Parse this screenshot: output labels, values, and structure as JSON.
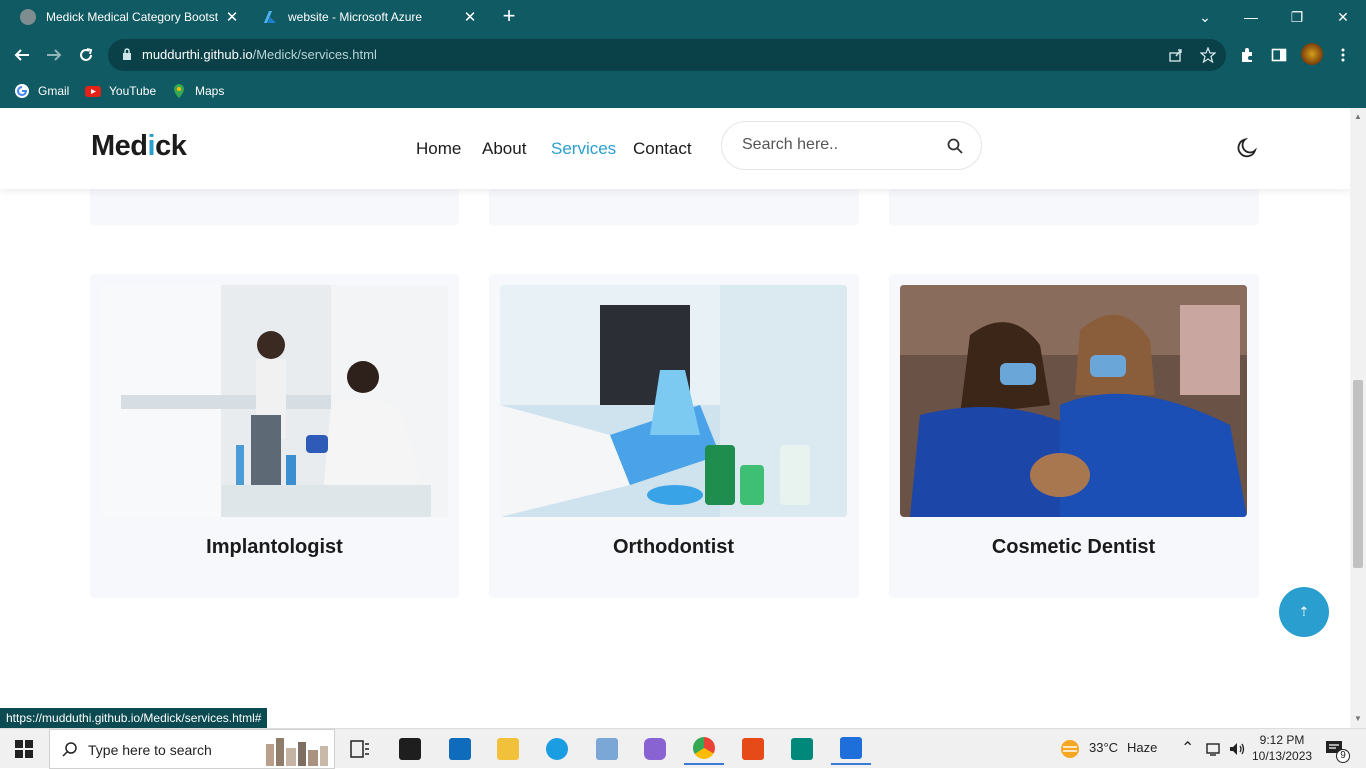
{
  "browser": {
    "tabs": [
      {
        "title": "Medick Medical Category Bootst",
        "close": "✕",
        "active": true
      },
      {
        "title": "website - Microsoft Azure",
        "close": "✕",
        "active": false
      }
    ],
    "new_tab": "+",
    "window_controls": {
      "collapse": "⌄",
      "minimize": "—",
      "restore": "❐",
      "close": "✕"
    },
    "url_host": "muddurthi.github.io",
    "url_path": "/Medick/services.html",
    "bookmarks": [
      {
        "label": "Gmail",
        "icon": "google-icon"
      },
      {
        "label": "YouTube",
        "icon": "youtube-icon"
      },
      {
        "label": "Maps",
        "icon": "maps-icon"
      }
    ],
    "status_url": "https://mudduthi.github.io/Medick/services.html#"
  },
  "site": {
    "logo_pre": "Med",
    "logo_i": "i",
    "logo_post": "ck",
    "nav": [
      {
        "label": "Home",
        "active": false
      },
      {
        "label": "About",
        "active": false
      },
      {
        "label": "Services",
        "active": true
      },
      {
        "label": "Contact",
        "active": false
      }
    ],
    "search_placeholder": "Search here..",
    "accent": "#2a9fcf"
  },
  "services": [
    {
      "title": "Implantologist",
      "image": "lab-scientists-microscope"
    },
    {
      "title": "Orthodontist",
      "image": "lab-flasks-gloved-hand"
    },
    {
      "title": "Cosmetic Dentist",
      "image": "dentists-with-patient"
    }
  ],
  "scroll_top_icon": "⇡",
  "taskbar": {
    "search_placeholder": "Type here to search",
    "weather_temp": "33°C",
    "weather_desc": "Haze",
    "time": "9:12 PM",
    "date": "10/13/2023",
    "notification_count": "9"
  }
}
